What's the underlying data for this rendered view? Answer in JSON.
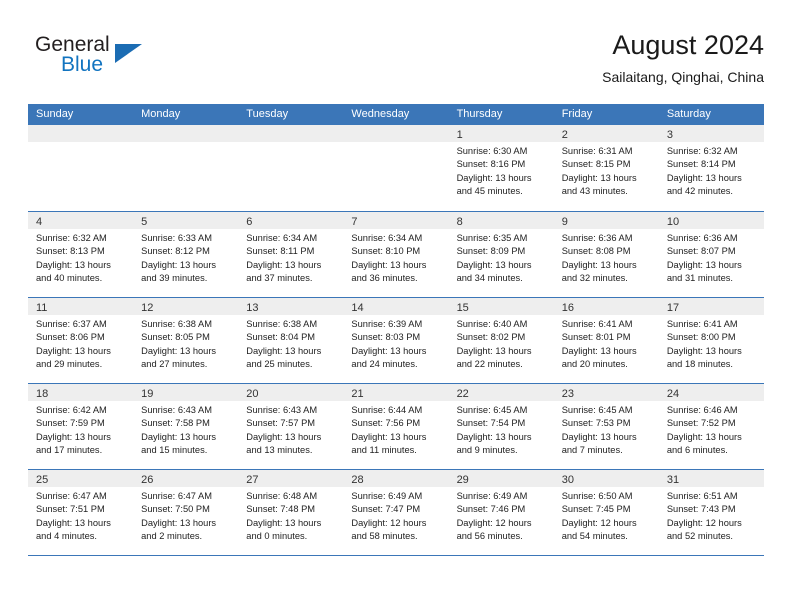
{
  "brand": {
    "name_line1": "General",
    "name_line2": "Blue",
    "triangle_color": "#1b6cb3",
    "blue": "#1274c0"
  },
  "header": {
    "title": "August 2024",
    "subtitle": "Sailaitang, Qinghai, China"
  },
  "theme": {
    "header_blue": "#3b76b8",
    "day_band_gray": "#eeeeee",
    "text": "#222222"
  },
  "weekdays": [
    "Sunday",
    "Monday",
    "Tuesday",
    "Wednesday",
    "Thursday",
    "Friday",
    "Saturday"
  ],
  "weeks": [
    [
      {
        "day": "",
        "sunrise": "",
        "sunset": "",
        "daylight1": "",
        "daylight2": ""
      },
      {
        "day": "",
        "sunrise": "",
        "sunset": "",
        "daylight1": "",
        "daylight2": ""
      },
      {
        "day": "",
        "sunrise": "",
        "sunset": "",
        "daylight1": "",
        "daylight2": ""
      },
      {
        "day": "",
        "sunrise": "",
        "sunset": "",
        "daylight1": "",
        "daylight2": ""
      },
      {
        "day": "1",
        "sunrise": "Sunrise: 6:30 AM",
        "sunset": "Sunset: 8:16 PM",
        "daylight1": "Daylight: 13 hours",
        "daylight2": "and 45 minutes."
      },
      {
        "day": "2",
        "sunrise": "Sunrise: 6:31 AM",
        "sunset": "Sunset: 8:15 PM",
        "daylight1": "Daylight: 13 hours",
        "daylight2": "and 43 minutes."
      },
      {
        "day": "3",
        "sunrise": "Sunrise: 6:32 AM",
        "sunset": "Sunset: 8:14 PM",
        "daylight1": "Daylight: 13 hours",
        "daylight2": "and 42 minutes."
      }
    ],
    [
      {
        "day": "4",
        "sunrise": "Sunrise: 6:32 AM",
        "sunset": "Sunset: 8:13 PM",
        "daylight1": "Daylight: 13 hours",
        "daylight2": "and 40 minutes."
      },
      {
        "day": "5",
        "sunrise": "Sunrise: 6:33 AM",
        "sunset": "Sunset: 8:12 PM",
        "daylight1": "Daylight: 13 hours",
        "daylight2": "and 39 minutes."
      },
      {
        "day": "6",
        "sunrise": "Sunrise: 6:34 AM",
        "sunset": "Sunset: 8:11 PM",
        "daylight1": "Daylight: 13 hours",
        "daylight2": "and 37 minutes."
      },
      {
        "day": "7",
        "sunrise": "Sunrise: 6:34 AM",
        "sunset": "Sunset: 8:10 PM",
        "daylight1": "Daylight: 13 hours",
        "daylight2": "and 36 minutes."
      },
      {
        "day": "8",
        "sunrise": "Sunrise: 6:35 AM",
        "sunset": "Sunset: 8:09 PM",
        "daylight1": "Daylight: 13 hours",
        "daylight2": "and 34 minutes."
      },
      {
        "day": "9",
        "sunrise": "Sunrise: 6:36 AM",
        "sunset": "Sunset: 8:08 PM",
        "daylight1": "Daylight: 13 hours",
        "daylight2": "and 32 minutes."
      },
      {
        "day": "10",
        "sunrise": "Sunrise: 6:36 AM",
        "sunset": "Sunset: 8:07 PM",
        "daylight1": "Daylight: 13 hours",
        "daylight2": "and 31 minutes."
      }
    ],
    [
      {
        "day": "11",
        "sunrise": "Sunrise: 6:37 AM",
        "sunset": "Sunset: 8:06 PM",
        "daylight1": "Daylight: 13 hours",
        "daylight2": "and 29 minutes."
      },
      {
        "day": "12",
        "sunrise": "Sunrise: 6:38 AM",
        "sunset": "Sunset: 8:05 PM",
        "daylight1": "Daylight: 13 hours",
        "daylight2": "and 27 minutes."
      },
      {
        "day": "13",
        "sunrise": "Sunrise: 6:38 AM",
        "sunset": "Sunset: 8:04 PM",
        "daylight1": "Daylight: 13 hours",
        "daylight2": "and 25 minutes."
      },
      {
        "day": "14",
        "sunrise": "Sunrise: 6:39 AM",
        "sunset": "Sunset: 8:03 PM",
        "daylight1": "Daylight: 13 hours",
        "daylight2": "and 24 minutes."
      },
      {
        "day": "15",
        "sunrise": "Sunrise: 6:40 AM",
        "sunset": "Sunset: 8:02 PM",
        "daylight1": "Daylight: 13 hours",
        "daylight2": "and 22 minutes."
      },
      {
        "day": "16",
        "sunrise": "Sunrise: 6:41 AM",
        "sunset": "Sunset: 8:01 PM",
        "daylight1": "Daylight: 13 hours",
        "daylight2": "and 20 minutes."
      },
      {
        "day": "17",
        "sunrise": "Sunrise: 6:41 AM",
        "sunset": "Sunset: 8:00 PM",
        "daylight1": "Daylight: 13 hours",
        "daylight2": "and 18 minutes."
      }
    ],
    [
      {
        "day": "18",
        "sunrise": "Sunrise: 6:42 AM",
        "sunset": "Sunset: 7:59 PM",
        "daylight1": "Daylight: 13 hours",
        "daylight2": "and 17 minutes."
      },
      {
        "day": "19",
        "sunrise": "Sunrise: 6:43 AM",
        "sunset": "Sunset: 7:58 PM",
        "daylight1": "Daylight: 13 hours",
        "daylight2": "and 15 minutes."
      },
      {
        "day": "20",
        "sunrise": "Sunrise: 6:43 AM",
        "sunset": "Sunset: 7:57 PM",
        "daylight1": "Daylight: 13 hours",
        "daylight2": "and 13 minutes."
      },
      {
        "day": "21",
        "sunrise": "Sunrise: 6:44 AM",
        "sunset": "Sunset: 7:56 PM",
        "daylight1": "Daylight: 13 hours",
        "daylight2": "and 11 minutes."
      },
      {
        "day": "22",
        "sunrise": "Sunrise: 6:45 AM",
        "sunset": "Sunset: 7:54 PM",
        "daylight1": "Daylight: 13 hours",
        "daylight2": "and 9 minutes."
      },
      {
        "day": "23",
        "sunrise": "Sunrise: 6:45 AM",
        "sunset": "Sunset: 7:53 PM",
        "daylight1": "Daylight: 13 hours",
        "daylight2": "and 7 minutes."
      },
      {
        "day": "24",
        "sunrise": "Sunrise: 6:46 AM",
        "sunset": "Sunset: 7:52 PM",
        "daylight1": "Daylight: 13 hours",
        "daylight2": "and 6 minutes."
      }
    ],
    [
      {
        "day": "25",
        "sunrise": "Sunrise: 6:47 AM",
        "sunset": "Sunset: 7:51 PM",
        "daylight1": "Daylight: 13 hours",
        "daylight2": "and 4 minutes."
      },
      {
        "day": "26",
        "sunrise": "Sunrise: 6:47 AM",
        "sunset": "Sunset: 7:50 PM",
        "daylight1": "Daylight: 13 hours",
        "daylight2": "and 2 minutes."
      },
      {
        "day": "27",
        "sunrise": "Sunrise: 6:48 AM",
        "sunset": "Sunset: 7:48 PM",
        "daylight1": "Daylight: 13 hours",
        "daylight2": "and 0 minutes."
      },
      {
        "day": "28",
        "sunrise": "Sunrise: 6:49 AM",
        "sunset": "Sunset: 7:47 PM",
        "daylight1": "Daylight: 12 hours",
        "daylight2": "and 58 minutes."
      },
      {
        "day": "29",
        "sunrise": "Sunrise: 6:49 AM",
        "sunset": "Sunset: 7:46 PM",
        "daylight1": "Daylight: 12 hours",
        "daylight2": "and 56 minutes."
      },
      {
        "day": "30",
        "sunrise": "Sunrise: 6:50 AM",
        "sunset": "Sunset: 7:45 PM",
        "daylight1": "Daylight: 12 hours",
        "daylight2": "and 54 minutes."
      },
      {
        "day": "31",
        "sunrise": "Sunrise: 6:51 AM",
        "sunset": "Sunset: 7:43 PM",
        "daylight1": "Daylight: 12 hours",
        "daylight2": "and 52 minutes."
      }
    ]
  ]
}
